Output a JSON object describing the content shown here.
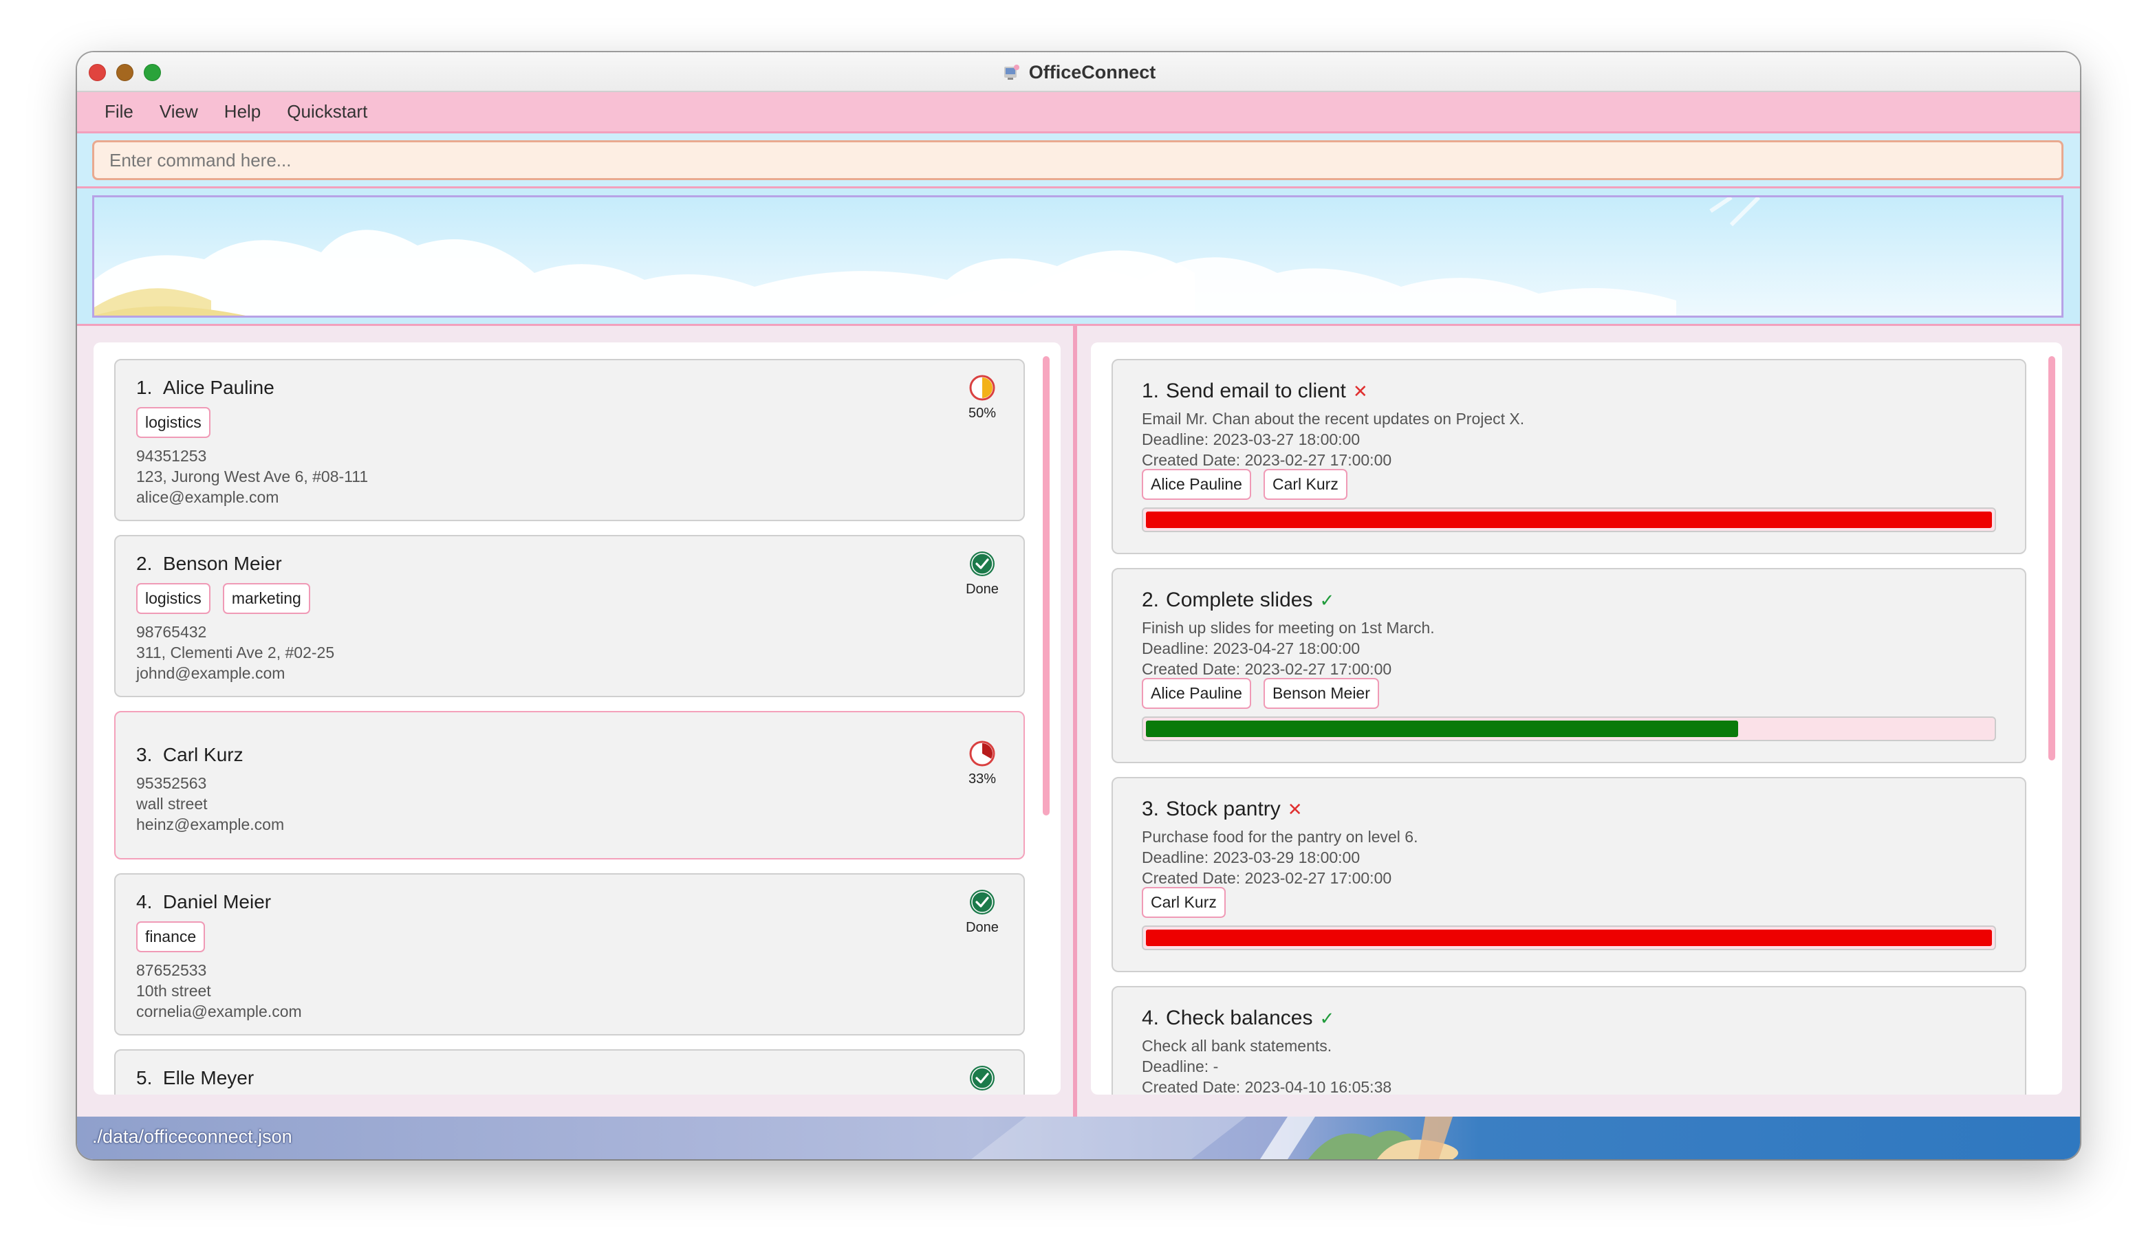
{
  "window": {
    "title": "OfficeConnect"
  },
  "menu": {
    "items": [
      "File",
      "View",
      "Help",
      "Quickstart"
    ]
  },
  "command": {
    "placeholder": "Enter command here...",
    "value": ""
  },
  "persons": [
    {
      "index": "1.",
      "name": "Alice Pauline",
      "tags": [
        "logistics"
      ],
      "phone": "94351253",
      "address": "123, Jurong West Ave 6, #08-111",
      "email": "alice@example.com",
      "status_icon": "half-pie-icon",
      "status": "50%"
    },
    {
      "index": "2.",
      "name": "Benson Meier",
      "tags": [
        "logistics",
        "marketing"
      ],
      "phone": "98765432",
      "address": "311, Clementi Ave 2, #02-25",
      "email": "johnd@example.com",
      "status_icon": "check-circle-icon",
      "status": "Done"
    },
    {
      "index": "3.",
      "name": "Carl Kurz",
      "tags": [],
      "phone": "95352563",
      "address": "wall street",
      "email": "heinz@example.com",
      "status_icon": "third-pie-icon",
      "status": "33%"
    },
    {
      "index": "4.",
      "name": "Daniel Meier",
      "tags": [
        "finance"
      ],
      "phone": "87652533",
      "address": "10th street",
      "email": "cornelia@example.com",
      "status_icon": "check-circle-icon",
      "status": "Done"
    },
    {
      "index": "5.",
      "name": "Elle Meyer",
      "tags": [],
      "phone": "",
      "address": "",
      "email": "",
      "status_icon": "check-circle-icon",
      "status": ""
    }
  ],
  "tasks": [
    {
      "index": "1.",
      "title": "Send email to client",
      "mark": "✕",
      "mark_type": "cross",
      "description": "Email Mr. Chan about the recent updates on Project X.",
      "deadline": "Deadline: 2023-03-27 18:00:00",
      "created": "Created Date: 2023-02-27 17:00:00",
      "assignees": [
        "Alice Pauline",
        "Carl Kurz"
      ],
      "progress": 1.0,
      "progress_color": "#ee0000"
    },
    {
      "index": "2.",
      "title": "Complete slides",
      "mark": "✓",
      "mark_type": "check",
      "description": "Finish up slides for meeting on 1st March.",
      "deadline": "Deadline: 2023-04-27 18:00:00",
      "created": "Created Date: 2023-02-27 17:00:00",
      "assignees": [
        "Alice Pauline",
        "Benson Meier"
      ],
      "progress": 0.7,
      "progress_color": "#0a7a0a"
    },
    {
      "index": "3.",
      "title": "Stock pantry",
      "mark": "✕",
      "mark_type": "cross",
      "description": "Purchase food for the pantry on level 6.",
      "deadline": "Deadline: 2023-03-29 18:00:00",
      "created": "Created Date: 2023-02-27 17:00:00",
      "assignees": [
        "Carl Kurz"
      ],
      "progress": 1.0,
      "progress_color": "#ee0000"
    },
    {
      "index": "4.",
      "title": "Check balances",
      "mark": "✓",
      "mark_type": "check",
      "description": "Check all bank statements.",
      "deadline": "Deadline: -",
      "created": "Created Date: 2023-04-10 16:05:38",
      "assignees": [],
      "progress": null,
      "progress_color": ""
    }
  ],
  "statusbar": {
    "path": "./data/officeconnect.json"
  }
}
